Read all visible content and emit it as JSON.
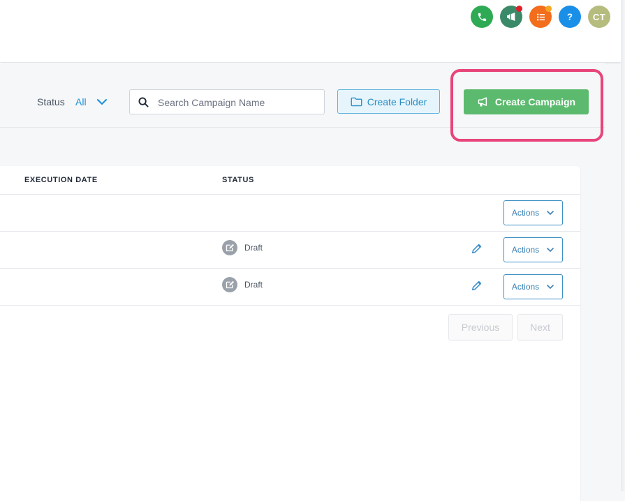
{
  "header": {
    "icons": [
      {
        "name": "phone-icon",
        "color": "#2eaa55"
      },
      {
        "name": "megaphone-icon",
        "color": "#3a8a6a",
        "badge_color": "#e11d2a"
      },
      {
        "name": "list-icon",
        "color": "#f26d1c",
        "badge_color": "#f5a623"
      },
      {
        "name": "help-icon",
        "color": "#1a8fe8"
      }
    ],
    "avatar": {
      "initials": "CT",
      "color": "#b5bc7d"
    }
  },
  "toolbar": {
    "status_label": "Status",
    "status_value": "All",
    "search_placeholder": "Search Campaign Name",
    "create_folder_label": "Create Folder",
    "create_campaign_label": "Create Campaign",
    "highlight_color": "#e8457a"
  },
  "table": {
    "columns": [
      "EXECUTION DATE",
      "STATUS"
    ],
    "rows": [
      {
        "status": "",
        "actions_label": "Actions"
      },
      {
        "status": "Draft",
        "actions_label": "Actions"
      },
      {
        "status": "Draft",
        "actions_label": "Actions"
      }
    ]
  },
  "pagination": {
    "previous_label": "Previous",
    "next_label": "Next"
  }
}
